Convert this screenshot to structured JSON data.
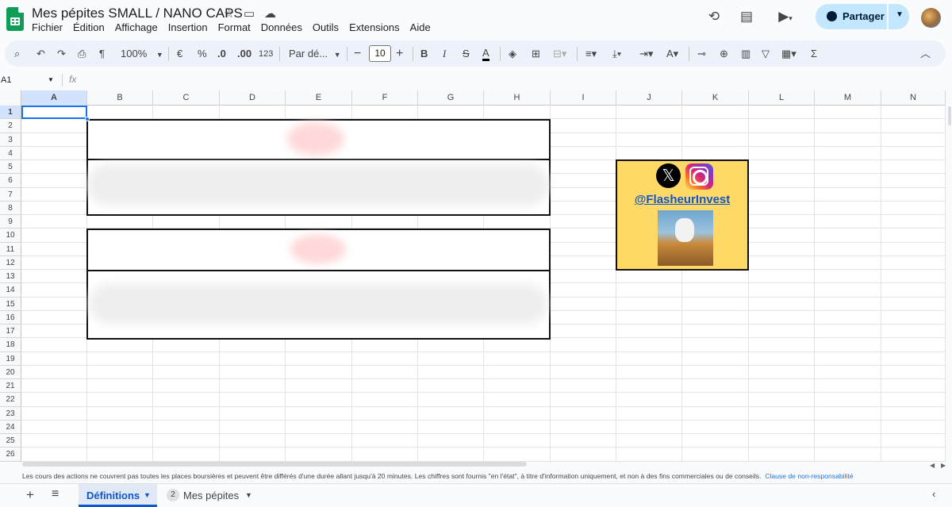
{
  "doc": {
    "title": "Mes pépites SMALL / NANO CAPS"
  },
  "menu": [
    "Fichier",
    "Édition",
    "Affichage",
    "Insertion",
    "Format",
    "Données",
    "Outils",
    "Extensions",
    "Aide"
  ],
  "share": {
    "label": "Partager"
  },
  "toolbar": {
    "zoom": "100%",
    "currency": "€",
    "percent": "%",
    "dec_minus": ".0",
    "dec_plus": ".00",
    "number_format": "123",
    "font": "Par dé...",
    "font_size": "10",
    "bold": "B",
    "italic": "I",
    "strike": "S",
    "text_color": "A",
    "sum": "Σ"
  },
  "formula_bar": {
    "cell_ref": "A1",
    "fx": "fx"
  },
  "columns": [
    "A",
    "B",
    "C",
    "D",
    "E",
    "F",
    "G",
    "H",
    "I",
    "J",
    "K",
    "L",
    "M",
    "N"
  ],
  "rows": [
    "1",
    "2",
    "3",
    "4",
    "5",
    "6",
    "7",
    "8",
    "9",
    "10",
    "11",
    "12",
    "13",
    "14",
    "15",
    "16",
    "17",
    "18",
    "19",
    "20",
    "21",
    "22",
    "23",
    "24",
    "25",
    "26"
  ],
  "promo": {
    "handle": "@FlasheurInvest",
    "x_glyph": "𝕏"
  },
  "footer": {
    "disclaimer": "Les cours des actions ne couvrent pas toutes les places boursières et peuvent être différés d'une durée allant jusqu'à 20 minutes. Les chiffres sont fournis \"en l'état\", à titre d'information uniquement, et non à des fins commerciales ou de conseils.",
    "link": "Clause de non-responsabilité"
  },
  "sheets": [
    {
      "name": "Définitions",
      "active": true
    },
    {
      "name": "Mes pépites",
      "badge": "2",
      "active": false
    }
  ],
  "colors": {
    "accent": "#0b57d0",
    "share_bg": "#c2e7ff",
    "promo_bg": "#ffd966",
    "sheets_green": "#0f9d58"
  }
}
